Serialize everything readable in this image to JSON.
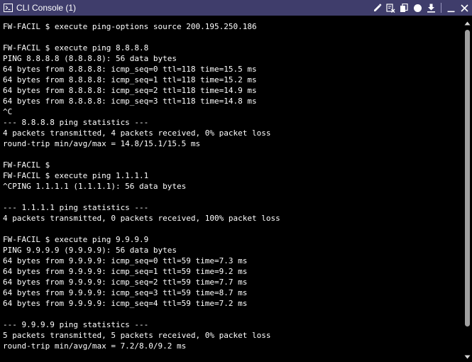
{
  "window": {
    "title": "CLI Console (1)",
    "title_icon": "terminal-icon",
    "colors": {
      "titlebar": "#3f3d6b",
      "console_bg": "#000000",
      "console_text": "#ffffff",
      "scrollbar_thumb": "#a0a0a0"
    }
  },
  "toolbar": {
    "icons": [
      "edit-icon",
      "clear-icon",
      "copy-icon",
      "record-icon",
      "download-icon",
      "minimize-icon",
      "close-icon"
    ]
  },
  "console": {
    "lines": [
      "FW-FACIL $ execute ping-options source 200.195.250.186",
      "",
      "FW-FACIL $ execute ping 8.8.8.8",
      "PING 8.8.8.8 (8.8.8.8): 56 data bytes",
      "64 bytes from 8.8.8.8: icmp_seq=0 ttl=118 time=15.5 ms",
      "64 bytes from 8.8.8.8: icmp_seq=1 ttl=118 time=15.2 ms",
      "64 bytes from 8.8.8.8: icmp_seq=2 ttl=118 time=14.9 ms",
      "64 bytes from 8.8.8.8: icmp_seq=3 ttl=118 time=14.8 ms",
      "^C",
      "--- 8.8.8.8 ping statistics ---",
      "4 packets transmitted, 4 packets received, 0% packet loss",
      "round-trip min/avg/max = 14.8/15.1/15.5 ms",
      "",
      "FW-FACIL $",
      "FW-FACIL $ execute ping 1.1.1.1",
      "^CPING 1.1.1.1 (1.1.1.1): 56 data bytes",
      "",
      "--- 1.1.1.1 ping statistics ---",
      "4 packets transmitted, 0 packets received, 100% packet loss",
      "",
      "FW-FACIL $ execute ping 9.9.9.9",
      "PING 9.9.9.9 (9.9.9.9): 56 data bytes",
      "64 bytes from 9.9.9.9: icmp_seq=0 ttl=59 time=7.3 ms",
      "64 bytes from 9.9.9.9: icmp_seq=1 ttl=59 time=9.2 ms",
      "64 bytes from 9.9.9.9: icmp_seq=2 ttl=59 time=7.7 ms",
      "64 bytes from 9.9.9.9: icmp_seq=3 ttl=59 time=8.7 ms",
      "64 bytes from 9.9.9.9: icmp_seq=4 ttl=59 time=7.2 ms",
      "",
      "--- 9.9.9.9 ping statistics ---",
      "5 packets transmitted, 5 packets received, 0% packet loss",
      "round-trip min/avg/max = 7.2/8.0/9.2 ms"
    ]
  },
  "scrollbar": {
    "up_icon": "scroll-up-arrow-icon",
    "down_icon": "scroll-down-arrow-icon"
  }
}
